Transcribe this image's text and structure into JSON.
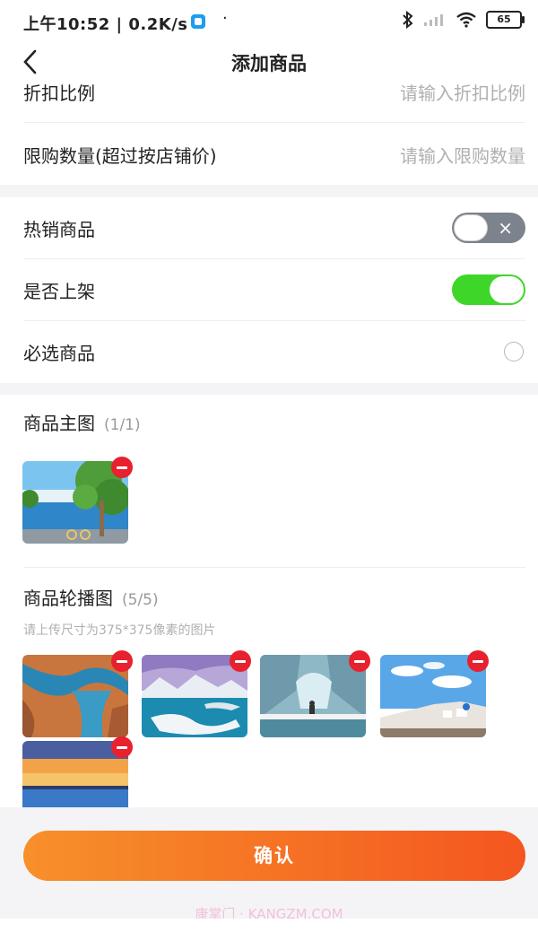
{
  "status_bar": {
    "time": "上午10:52 | 0.2K/s",
    "dot": "·",
    "battery": "65",
    "icons": [
      "bluetooth-icon",
      "signal-icon",
      "wifi-icon",
      "battery-icon"
    ]
  },
  "navbar": {
    "back_icon": "‹",
    "title": "添加商品"
  },
  "form": {
    "discount": {
      "label": "折扣比例",
      "placeholder": "请输入折扣比例"
    },
    "limit": {
      "label": "限购数量(超过按店铺价)",
      "placeholder": "请输入限购数量"
    },
    "hot": {
      "label": "热销商品",
      "on": false,
      "x": "×"
    },
    "shelf": {
      "label": "是否上架",
      "on": true
    },
    "required": {
      "label": "必选商品",
      "checked": false
    }
  },
  "main_image": {
    "title": "商品主图",
    "count": "(1/1)",
    "images": [
      "lakeside-trees-photo"
    ]
  },
  "carousel": {
    "title": "商品轮播图",
    "count": "(5/5)",
    "hint": "请上传尺寸为375*375像素的图片",
    "images": [
      "canyon-aerial-photo",
      "snowy-islands-photo",
      "glacier-bridge-photo",
      "coastal-town-photo",
      "sunset-lake-photo"
    ]
  },
  "confirm_label": "确认",
  "watermark": "康掌门 · KANGZM.COM",
  "colors": {
    "accent_start": "#f7902a",
    "accent_end": "#f4561f",
    "toggle_on": "#3fd62a",
    "delete_red": "#e8212e"
  }
}
